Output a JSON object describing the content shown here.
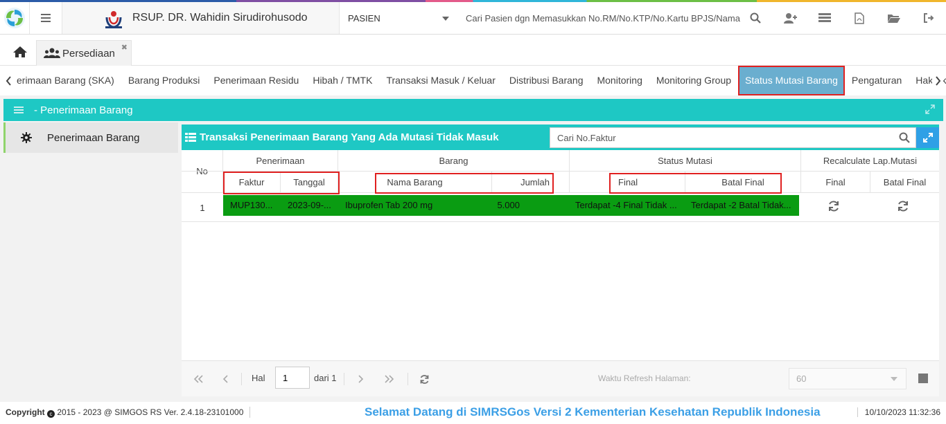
{
  "topbar": {
    "hospital_name": "RSUP. DR. Wahidin Sirudirohusodo",
    "search_type": "PASIEN",
    "search_hint": "Cari Pasien dgn Memasukkan No.RM/No.KTP/No.Kartu BPJS/Nama",
    "icons": [
      "search-icon",
      "add-user-icon",
      "list-icon",
      "pdf-icon",
      "folder-icon",
      "logout-icon"
    ]
  },
  "tabs": {
    "active_label": "Persediaan"
  },
  "menu": {
    "items": [
      {
        "label": "erimaan Barang (SKA)"
      },
      {
        "label": "Barang Produksi"
      },
      {
        "label": "Penerimaan Residu"
      },
      {
        "label": "Hibah / TMTK"
      },
      {
        "label": "Transaksi Masuk / Keluar"
      },
      {
        "label": "Distribusi Barang"
      },
      {
        "label": "Monitoring"
      },
      {
        "label": "Monitoring Group"
      },
      {
        "label": "Status Mutasi Barang",
        "active": true
      },
      {
        "label": "Pengaturan"
      },
      {
        "label": "Hak Akses"
      }
    ]
  },
  "module": {
    "title": "- Penerimaan Barang"
  },
  "sidebar": {
    "items": [
      {
        "label": "Penerimaan Barang"
      }
    ]
  },
  "panel": {
    "title": "Transaksi Penerimaan Barang Yang Ada Mutasi Tidak Masuk",
    "search_placeholder": "Cari No.Faktur"
  },
  "table": {
    "col_no": "No",
    "groups": {
      "penerimaan": "Penerimaan",
      "barang": "Barang",
      "status_mutasi": "Status Mutasi",
      "recalculate": "Recalculate Lap.Mutasi"
    },
    "sub": {
      "faktur": "Faktur",
      "tanggal": "Tanggal",
      "nama_barang": "Nama Barang",
      "jumlah": "Jumlah",
      "final": "Final",
      "batal_final": "Batal Final",
      "rc_final": "Final",
      "rc_batal_final": "Batal Final"
    },
    "rows": [
      {
        "no": "1",
        "faktur": "MUP130...",
        "tanggal": "2023-09-...",
        "nama_barang": "Ibuprofen Tab 200 mg",
        "jumlah": "5.000",
        "final": "Terdapat -4 Final Tidak ...",
        "batal_final": "Terdapat -2 Batal Tidak..."
      }
    ]
  },
  "pager": {
    "hal_label": "Hal",
    "page": "1",
    "dari_label": "dari 1",
    "refresh_label": "Waktu Refresh Halaman:",
    "refresh_value": "60"
  },
  "footer": {
    "copyright_word": "Copyright",
    "copyright_rest": "2015 - 2023 @ SIMGOS RS Ver. 2.4.18-23101000",
    "welcome": "Selamat Datang di SIMRSGos Versi 2 Kementerian Kesehatan Republik Indonesia",
    "datetime": "10/10/2023 11:32:36"
  },
  "colors": {
    "teal": "#1ec8c4",
    "row_highlight": "#0a9c12",
    "active_tab": "#6aaecf",
    "annotation_red": "#e02020",
    "welcome_blue": "#3b9fe6"
  }
}
